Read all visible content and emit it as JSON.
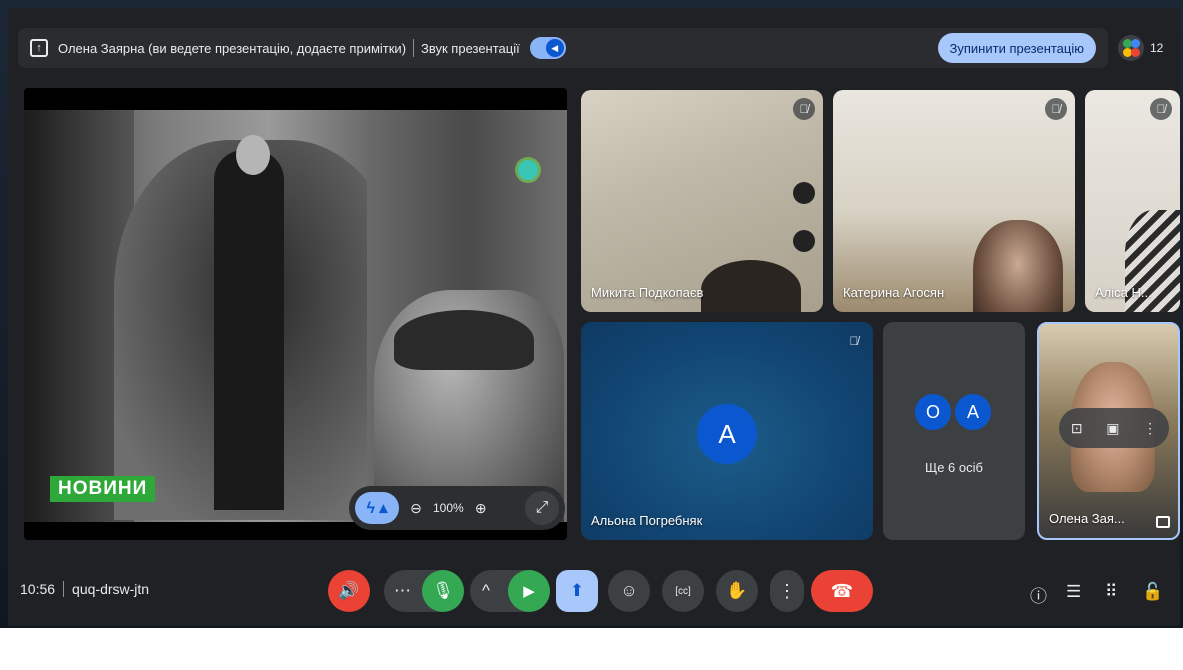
{
  "presentation_bar": {
    "presenter_text": "Олена Заярна (ви ведете презентацію, додаєте примітки)",
    "sound_label": "Звук презентації",
    "stop_button": "Зупинити презентацію",
    "participant_count": "12"
  },
  "main_video": {
    "news_badge": "НОВИНИ",
    "zoom_value": "100%"
  },
  "participants": [
    {
      "name": "Микита Подкопаєв",
      "muted": true
    },
    {
      "name": "Катерина Агосян",
      "muted": true
    },
    {
      "name": "Аліса Н...",
      "muted": true
    },
    {
      "name": "Альона Погребняк",
      "avatar_letter": "А",
      "muted": true
    },
    {
      "name": "Олена Зая...",
      "self": true
    }
  ],
  "others_tile": {
    "avatar_1": "О",
    "avatar_2": "А",
    "label": "Ще 6 осіб"
  },
  "toolbar": {
    "time": "10:56",
    "meeting_code": "quq-drsw-jtn"
  },
  "colors": {
    "background": "#202124",
    "accent_blue": "#a8c7fa",
    "red": "#ea4335",
    "green": "#34a853"
  }
}
